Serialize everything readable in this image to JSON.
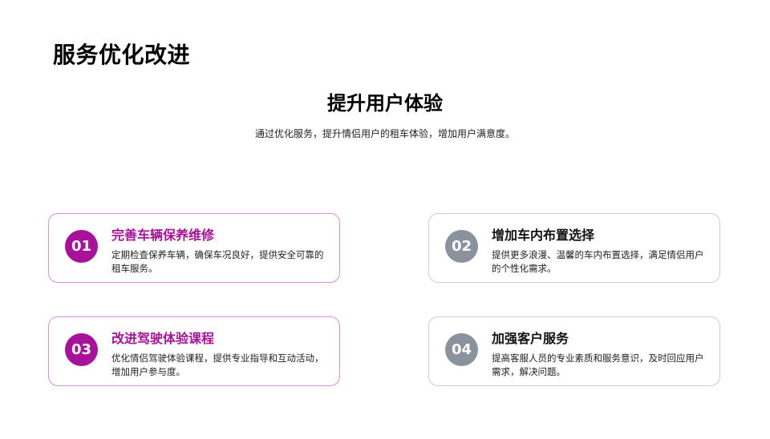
{
  "page": {
    "title": "服务优化改进"
  },
  "section": {
    "title": "提升用户体验",
    "subtitle": "通过优化服务，提升情侣用户的租车体验，增加用户满意度。"
  },
  "cards": [
    {
      "number": "01",
      "title": "完善车辆保养维修",
      "description": "定期检查保养车辆，确保车况良好，提供安全可靠的租车服务。"
    },
    {
      "number": "02",
      "title": "增加车内布置选择",
      "description": "提供更多浪漫、温馨的车内布置选择，满足情侣用户的个性化需求。"
    },
    {
      "number": "03",
      "title": "改进驾驶体验课程",
      "description": "优化情侣驾驶体验课程，提供专业指导和互动活动，增加用户参与度。"
    },
    {
      "number": "04",
      "title": "加强客户服务",
      "description": "提高客服人员的专业素质和服务意识，及时回应用户需求，解决问题。"
    }
  ],
  "colors": {
    "accent": "#a8129b",
    "accent_border": "#dc8fde",
    "neutral": "#8a929e",
    "neutral_border": "#cccccc"
  }
}
